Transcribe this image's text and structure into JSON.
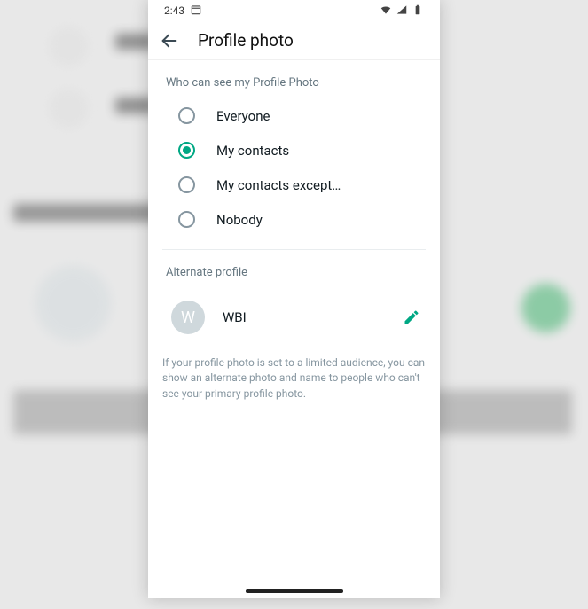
{
  "statusBar": {
    "time": "2:43"
  },
  "appBar": {
    "title": "Profile photo"
  },
  "visibility": {
    "header": "Who can see my Profile Photo",
    "options": [
      {
        "label": "Everyone",
        "selected": false
      },
      {
        "label": "My contacts",
        "selected": true
      },
      {
        "label": "My contacts except…",
        "selected": false
      },
      {
        "label": "Nobody",
        "selected": false
      }
    ]
  },
  "alternate": {
    "header": "Alternate profile",
    "avatarInitial": "W",
    "name": "WBI",
    "helper": "If your profile photo is set to a limited audience, you can show an alternate photo and name to people who can't see your primary profile photo."
  },
  "colors": {
    "accent": "#00a884"
  }
}
